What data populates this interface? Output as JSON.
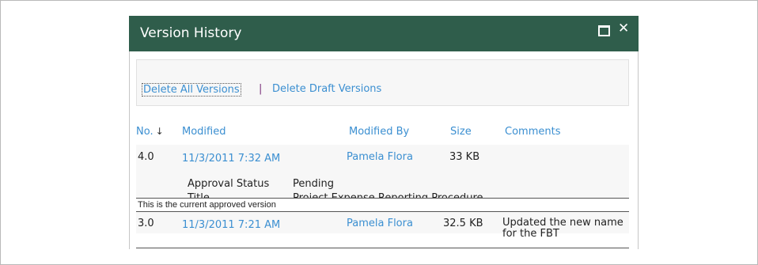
{
  "dialog": {
    "title": "Version History"
  },
  "toolbar": {
    "delete_all": "Delete All Versions",
    "separator": "|",
    "delete_draft": "Delete Draft Versions"
  },
  "columns": {
    "no": "No.",
    "sort_indicator": "↓",
    "modified": "Modified",
    "modified_by": "Modified By",
    "size": "Size",
    "comments": "Comments"
  },
  "versions": [
    {
      "no": "4.0",
      "modified": "11/3/2011 7:32 AM",
      "modified_by": "Pamela Flora",
      "size": "33 KB",
      "comments": "",
      "details": [
        {
          "label": "Approval Status",
          "value": "Pending"
        },
        {
          "label": "Title",
          "value": "Project Expense Reporting Procedure"
        }
      ]
    },
    {
      "no": "3.0",
      "modified": "11/3/2011 7:21 AM",
      "modified_by": "Pamela Flora",
      "size": "32.5 KB",
      "comments": "Updated the new name for the FBT"
    }
  ],
  "current_version_note": "This is the current approved version",
  "colors": {
    "titlebar": "#2f5d4b",
    "link": "#3b8fd1"
  }
}
